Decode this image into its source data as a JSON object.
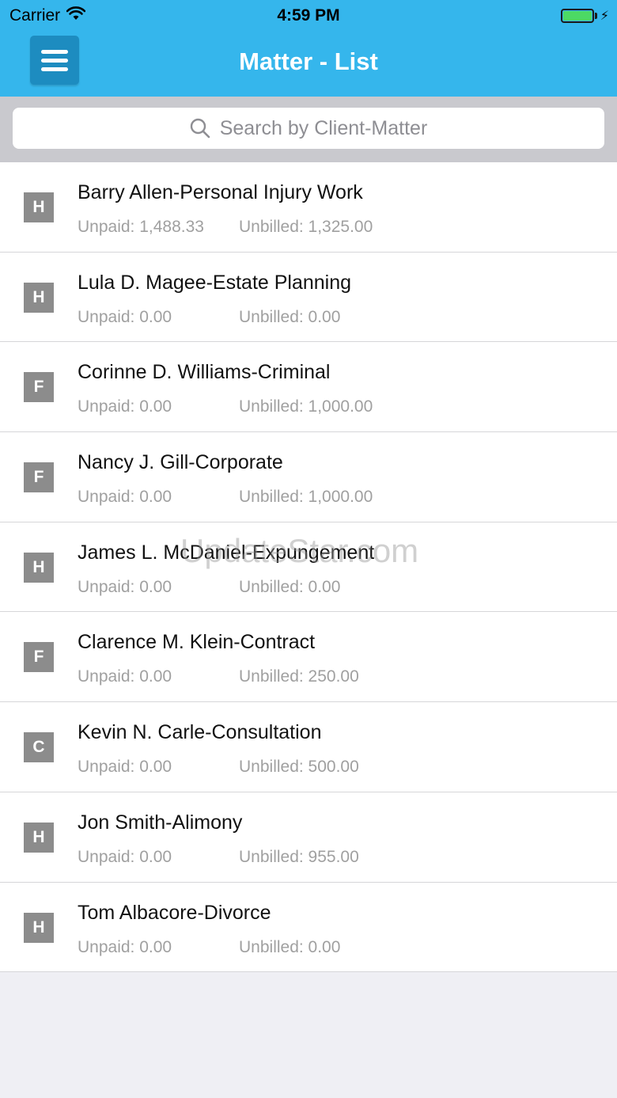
{
  "status_bar": {
    "carrier": "Carrier",
    "time": "4:59 PM",
    "battery_color": "#4cd964"
  },
  "nav": {
    "title": "Matter - List",
    "menu_icon": "hamburger-menu-icon",
    "bar_color": "#35b6ec"
  },
  "search": {
    "placeholder": "Search by Client-Matter"
  },
  "matters": [
    {
      "badge": "H",
      "title": "Barry Allen-Personal Injury Work",
      "unpaid": "Unpaid: 1,488.33",
      "unbilled": "Unbilled: 1,325.00"
    },
    {
      "badge": "H",
      "title": "Lula D. Magee-Estate Planning",
      "unpaid": "Unpaid: 0.00",
      "unbilled": "Unbilled: 0.00"
    },
    {
      "badge": "F",
      "title": "Corinne D. Williams-Criminal",
      "unpaid": "Unpaid: 0.00",
      "unbilled": "Unbilled: 1,000.00"
    },
    {
      "badge": "F",
      "title": "Nancy J. Gill-Corporate",
      "unpaid": "Unpaid: 0.00",
      "unbilled": "Unbilled: 1,000.00"
    },
    {
      "badge": "H",
      "title": "James L. McDaniel-Expungement",
      "unpaid": "Unpaid: 0.00",
      "unbilled": "Unbilled: 0.00"
    },
    {
      "badge": "F",
      "title": "Clarence M. Klein-Contract",
      "unpaid": "Unpaid: 0.00",
      "unbilled": "Unbilled: 250.00"
    },
    {
      "badge": "C",
      "title": "Kevin N. Carle-Consultation",
      "unpaid": "Unpaid: 0.00",
      "unbilled": "Unbilled: 500.00"
    },
    {
      "badge": "H",
      "title": "Jon Smith-Alimony",
      "unpaid": "Unpaid: 0.00",
      "unbilled": "Unbilled: 955.00"
    },
    {
      "badge": "H",
      "title": "Tom Albacore-Divorce",
      "unpaid": "Unpaid: 0.00",
      "unbilled": "Unbilled: 0.00"
    }
  ],
  "watermark": "UpdateStar.com"
}
